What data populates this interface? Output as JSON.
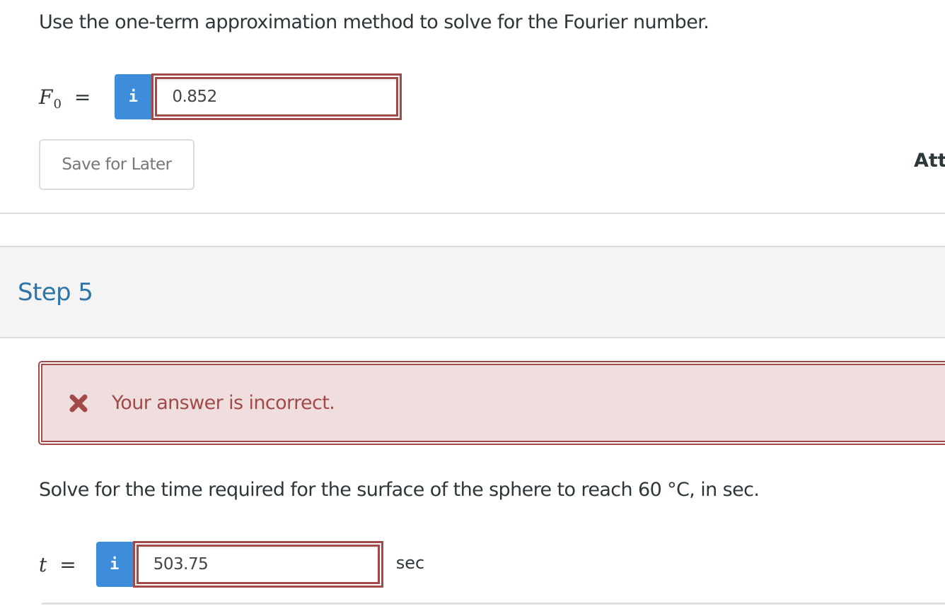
{
  "step4": {
    "prompt": "Use the one-term approximation method to solve for the Fourier number.",
    "variable": {
      "symbol": "F",
      "subscript": "0",
      "equals": "="
    },
    "info_icon": "i",
    "answer_value": "0.852",
    "save_button_label": "Save for Later",
    "attempts_label": "Att"
  },
  "step5": {
    "title": "Step 5",
    "feedback": {
      "icon": "x-mark-icon",
      "text": "Your answer is incorrect.",
      "status": "incorrect"
    },
    "question": "Solve for the time required for the surface of the sphere to reach 60 °C, in sec.",
    "variable": {
      "symbol": "t",
      "equals": "="
    },
    "info_icon": "i",
    "answer_value": "503.75",
    "unit": "sec"
  },
  "colors": {
    "info_blue": "#3d8ddb",
    "error_red": "#a14a47",
    "error_bg": "#f0dede",
    "step_title_blue": "#2e74a8",
    "header_bg": "#f4f4f4"
  }
}
